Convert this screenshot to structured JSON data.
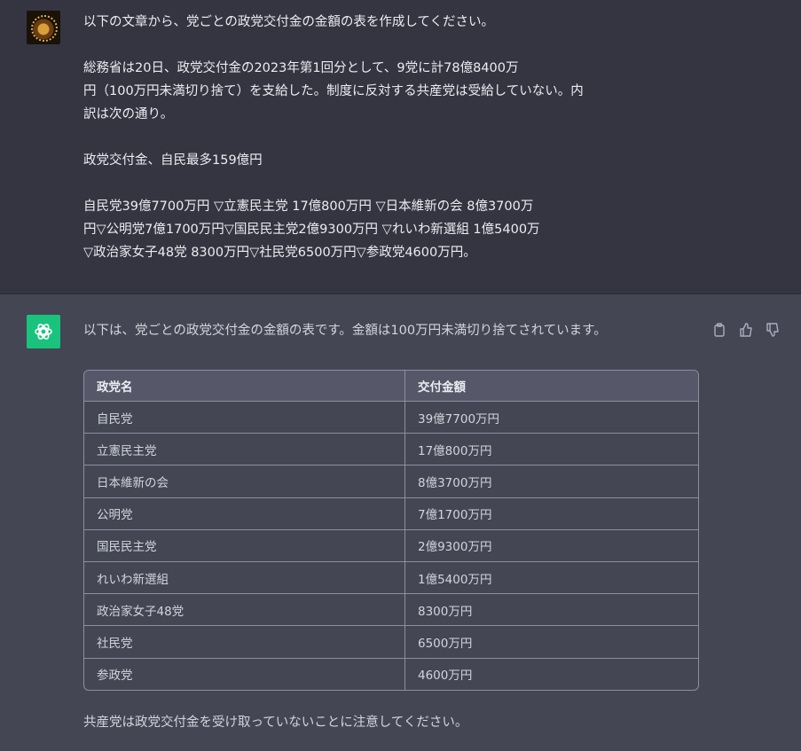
{
  "user_message": {
    "paragraphs": [
      "以下の文章から、党ごとの政党交付金の金額の表を作成してください。",
      "総務省は20日、政党交付金の2023年第1回分として、9党に計78億8400万\n円（100万円未満切り捨て）を支給した。制度に反対する共産党は受給していない。内\n訳は次の通り。",
      "政党交付金、自民最多159億円",
      "自民党39億7700万円 ▽立憲民主党 17億800万円 ▽日本維新の会 8億3700万\n円▽公明党7億1700万円▽国民民主党2億9300万円 ▽れいわ新選組 1億5400万\n▽政治家女子48党 8300万円▽社民党6500万円▽参政党4600万円。"
    ]
  },
  "assistant_message": {
    "intro": "以下は、党ごとの政党交付金の金額の表です。金額は100万円未満切り捨てされています。",
    "table": {
      "headers": [
        "政党名",
        "交付金額"
      ],
      "rows": [
        [
          "自民党",
          "39億7700万円"
        ],
        [
          "立憲民主党",
          "17億800万円"
        ],
        [
          "日本維新の会",
          "8億3700万円"
        ],
        [
          "公明党",
          "7億1700万円"
        ],
        [
          "国民民主党",
          "2億9300万円"
        ],
        [
          "れいわ新選組",
          "1億5400万円"
        ],
        [
          "政治家女子48党",
          "8300万円"
        ],
        [
          "社民党",
          "6500万円"
        ],
        [
          "参政党",
          "4600万円"
        ]
      ]
    },
    "note": "共産党は政党交付金を受け取っていないことに注意してください。",
    "actions": [
      "copy-icon",
      "thumbs-up-icon",
      "thumbs-down-icon"
    ]
  },
  "colors": {
    "user_bg": "#343541",
    "assistant_bg": "#444654",
    "gpt_avatar": "#19c37d",
    "table_header_bg": "#565869",
    "border": "#8e8ea0"
  }
}
